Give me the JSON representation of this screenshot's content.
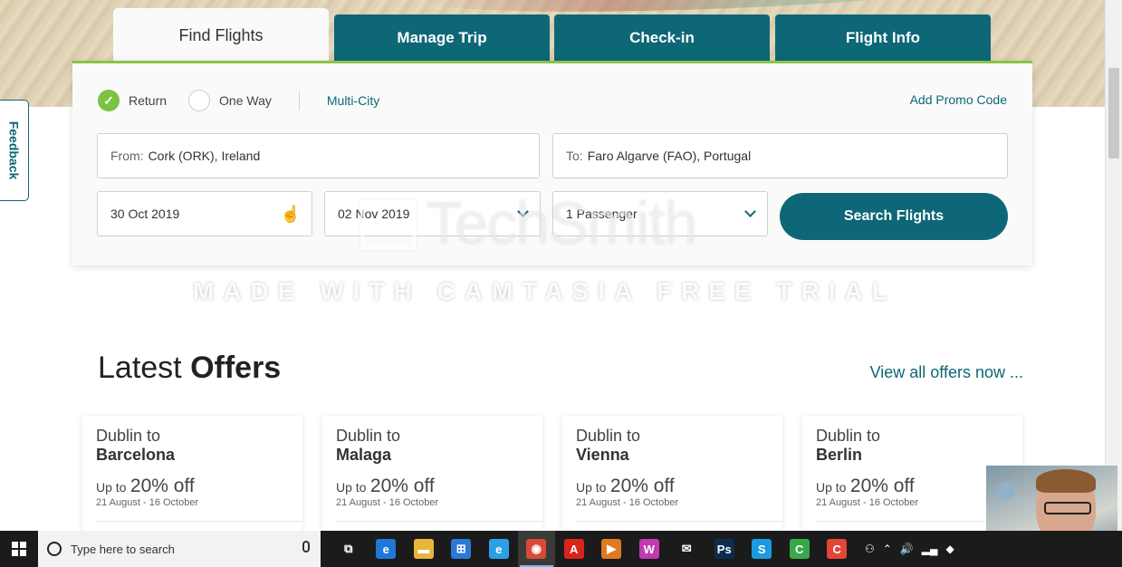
{
  "tabs": [
    {
      "label": "Find Flights",
      "active": true
    },
    {
      "label": "Manage Trip",
      "active": false
    },
    {
      "label": "Check-in",
      "active": false
    },
    {
      "label": "Flight Info",
      "active": false
    }
  ],
  "trip_type": {
    "return_label": "Return",
    "one_way_label": "One Way",
    "multi_city_label": "Multi-City",
    "selected": "Return"
  },
  "promo_link": "Add Promo Code",
  "from_field": {
    "label": "From:",
    "value": "Cork (ORK), Ireland"
  },
  "to_field": {
    "label": "To:",
    "value": "Faro Algarve (FAO), Portugal"
  },
  "depart_date": "30 Oct 2019",
  "return_date": "02 Nov 2019",
  "passengers": "1 Passenger",
  "search_button": "Search Flights",
  "feedback_tab": "Feedback",
  "watermark": {
    "logo": "TechSmith",
    "text": "MADE WITH CAMTASIA FREE TRIAL"
  },
  "offers": {
    "title_light": "Latest",
    "title_bold": "Offers",
    "view_all": "View all offers now ...",
    "cards": [
      {
        "from": "Dublin to",
        "dest": "Barcelona",
        "upto": "Up to",
        "pct": "20% off",
        "dates": "21 August - 16 October"
      },
      {
        "from": "Dublin to",
        "dest": "Malaga",
        "upto": "Up to",
        "pct": "20% off",
        "dates": "21 August - 16 October"
      },
      {
        "from": "Dublin to",
        "dest": "Vienna",
        "upto": "Up to",
        "pct": "20% off",
        "dates": "21 August - 16 October"
      },
      {
        "from": "Dublin to",
        "dest": "Berlin",
        "upto": "Up to",
        "pct": "20% off",
        "dates": "21 August - 16 October"
      }
    ]
  },
  "taskbar": {
    "search_placeholder": "Type here to search",
    "apps": [
      {
        "icon": "task-view-icon",
        "glyph": "⧉",
        "color": "#1b1b1b"
      },
      {
        "icon": "edge-icon",
        "glyph": "e",
        "color": "#1e78d6"
      },
      {
        "icon": "file-explorer-icon",
        "glyph": "▬",
        "color": "#e8b43a"
      },
      {
        "icon": "store-icon",
        "glyph": "⊞",
        "color": "#2b78d6"
      },
      {
        "icon": "internet-explorer-icon",
        "glyph": "e",
        "color": "#2aa0e8"
      },
      {
        "icon": "chrome-icon",
        "glyph": "◉",
        "color": "#d94a36"
      },
      {
        "icon": "acrobat-icon",
        "glyph": "A",
        "color": "#d9241b"
      },
      {
        "icon": "media-player-icon",
        "glyph": "▶",
        "color": "#e07a1e"
      },
      {
        "icon": "app-w-icon",
        "glyph": "W",
        "color": "#c23ab0"
      },
      {
        "icon": "mail-icon",
        "glyph": "✉",
        "color": "#1b1b1b"
      },
      {
        "icon": "photoshop-icon",
        "glyph": "Ps",
        "color": "#0b2d4e"
      },
      {
        "icon": "skype-icon",
        "glyph": "S",
        "color": "#1a9be0"
      },
      {
        "icon": "camtasia-green-icon",
        "glyph": "C",
        "color": "#37a84a"
      },
      {
        "icon": "camtasia-red-icon",
        "glyph": "C",
        "color": "#e3453a"
      }
    ]
  },
  "colors": {
    "brand_teal": "#0d6777",
    "accent_green": "#7cc243"
  }
}
